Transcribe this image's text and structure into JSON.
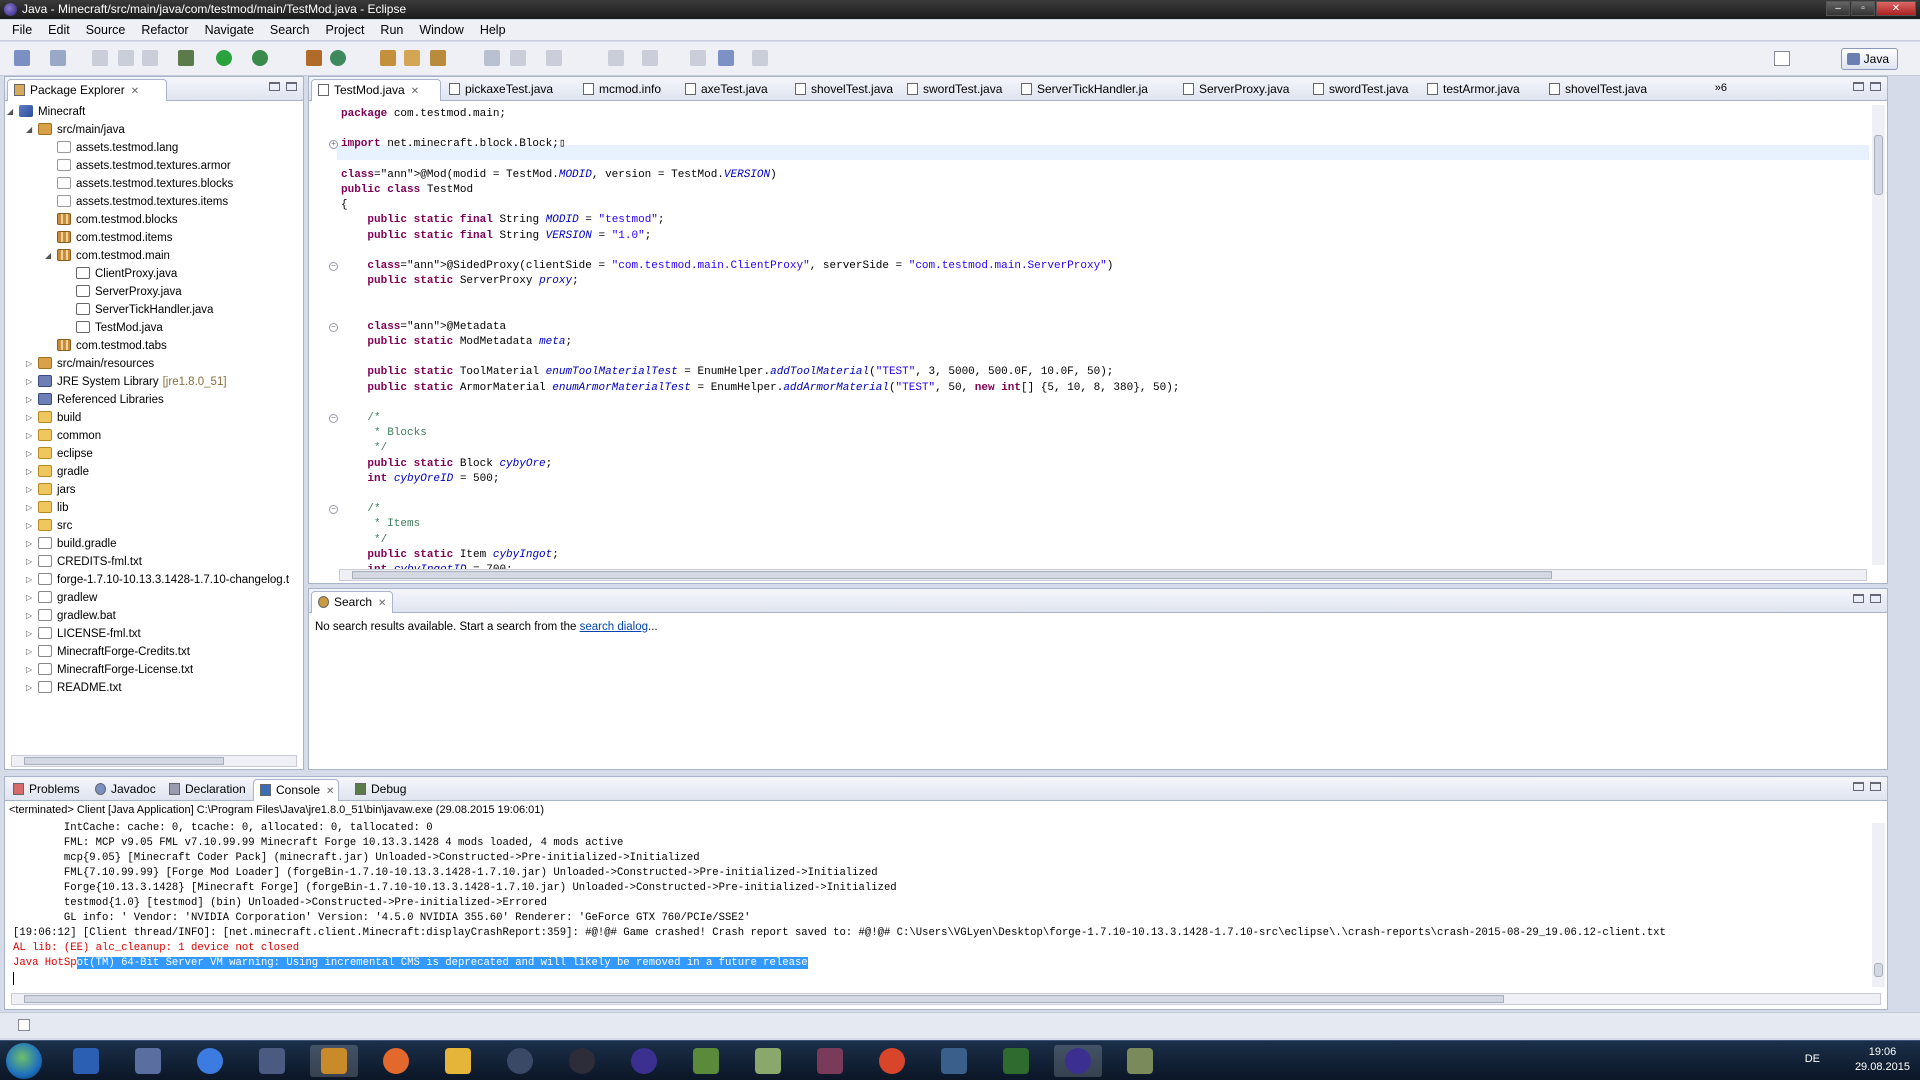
{
  "window": {
    "title": "Java - Minecraft/src/main/java/com/testmod/main/TestMod.java - Eclipse"
  },
  "menu": [
    "File",
    "Edit",
    "Source",
    "Refactor",
    "Navigate",
    "Search",
    "Project",
    "Run",
    "Window",
    "Help"
  ],
  "perspective": {
    "label": "Java"
  },
  "package_explorer": {
    "tab_label": "Package Explorer",
    "items": [
      {
        "label": "Minecraft",
        "icon": "project-icon",
        "level": 0,
        "expanded": true
      },
      {
        "label": "src/main/java",
        "icon": "source-folder-icon",
        "level": 1,
        "expanded": true
      },
      {
        "label": "assets.testmod.lang",
        "icon": "package-empty-icon",
        "level": 2
      },
      {
        "label": "assets.testmod.textures.armor",
        "icon": "package-empty-icon",
        "level": 2
      },
      {
        "label": "assets.testmod.textures.blocks",
        "icon": "package-empty-icon",
        "level": 2
      },
      {
        "label": "assets.testmod.textures.items",
        "icon": "package-empty-icon",
        "level": 2
      },
      {
        "label": "com.testmod.blocks",
        "icon": "package-icon",
        "level": 2
      },
      {
        "label": "com.testmod.items",
        "icon": "package-icon",
        "level": 2
      },
      {
        "label": "com.testmod.main",
        "icon": "package-icon",
        "level": 2,
        "expanded": true
      },
      {
        "label": "ClientProxy.java",
        "icon": "java-file-icon",
        "level": 3
      },
      {
        "label": "ServerProxy.java",
        "icon": "java-file-icon",
        "level": 3
      },
      {
        "label": "ServerTickHandler.java",
        "icon": "java-file-icon",
        "level": 3
      },
      {
        "label": "TestMod.java",
        "icon": "java-file-icon",
        "level": 3
      },
      {
        "label": "com.testmod.tabs",
        "icon": "package-icon",
        "level": 2
      },
      {
        "label": "src/main/resources",
        "icon": "source-folder-icon",
        "level": 1
      },
      {
        "label": "JRE System Library",
        "suffix": "[jre1.8.0_51]",
        "icon": "library-icon",
        "level": 1
      },
      {
        "label": "Referenced Libraries",
        "icon": "library-icon",
        "level": 1
      },
      {
        "label": "build",
        "icon": "folder-icon",
        "level": 1
      },
      {
        "label": "common",
        "icon": "folder-icon",
        "level": 1
      },
      {
        "label": "eclipse",
        "icon": "folder-icon",
        "level": 1
      },
      {
        "label": "gradle",
        "icon": "folder-icon",
        "level": 1
      },
      {
        "label": "jars",
        "icon": "folder-icon",
        "level": 1
      },
      {
        "label": "lib",
        "icon": "folder-icon",
        "level": 1
      },
      {
        "label": "src",
        "icon": "folder-icon",
        "level": 1
      },
      {
        "label": "build.gradle",
        "icon": "file-icon",
        "level": 1
      },
      {
        "label": "CREDITS-fml.txt",
        "icon": "file-icon",
        "level": 1
      },
      {
        "label": "forge-1.7.10-10.13.3.1428-1.7.10-changelog.t",
        "icon": "file-icon",
        "level": 1
      },
      {
        "label": "gradlew",
        "icon": "file-icon",
        "level": 1
      },
      {
        "label": "gradlew.bat",
        "icon": "file-icon",
        "level": 1
      },
      {
        "label": "LICENSE-fml.txt",
        "icon": "file-icon",
        "level": 1
      },
      {
        "label": "MinecraftForge-Credits.txt",
        "icon": "file-icon",
        "level": 1
      },
      {
        "label": "MinecraftForge-License.txt",
        "icon": "file-icon",
        "level": 1
      },
      {
        "label": "README.txt",
        "icon": "file-icon",
        "level": 1
      }
    ]
  },
  "editor": {
    "tabs": [
      "TestMod.java",
      "pickaxeTest.java",
      "mcmod.info",
      "axeTest.java",
      "shovelTest.java",
      "swordTest.java",
      "ServerTickHandler.ja",
      "ServerProxy.java",
      "swordTest.java",
      "testArmor.java",
      "shovelTest.java"
    ],
    "overflow_count": "»6",
    "lines": [
      {
        "t": "package com.testmod.main;"
      },
      {
        "t": ""
      },
      {
        "t": "import net.minecraft.block.Block;▯"
      },
      {
        "t": ""
      },
      {
        "t": "@Mod(modid = TestMod.MODID, version = TestMod.VERSION)"
      },
      {
        "t": "public class TestMod"
      },
      {
        "t": "{"
      },
      {
        "t": "    public static final String MODID = \"testmod\";"
      },
      {
        "t": "    public static final String VERSION = \"1.0\";"
      },
      {
        "t": ""
      },
      {
        "t": "    @SidedProxy(clientSide = \"com.testmod.main.ClientProxy\", serverSide = \"com.testmod.main.ServerProxy\")"
      },
      {
        "t": "    public static ServerProxy proxy;"
      },
      {
        "t": ""
      },
      {
        "t": ""
      },
      {
        "t": "    @Metadata"
      },
      {
        "t": "    public static ModMetadata meta;"
      },
      {
        "t": ""
      },
      {
        "t": "    public static ToolMaterial enumToolMaterialTest = EnumHelper.addToolMaterial(\"TEST\", 3, 5000, 500.0F, 10.0F, 50);"
      },
      {
        "t": "    public static ArmorMaterial enumArmorMaterialTest = EnumHelper.addArmorMaterial(\"TEST\", 50, new int[] {5, 10, 8, 380}, 50);"
      },
      {
        "t": ""
      },
      {
        "t": "    /*"
      },
      {
        "t": "     * Blocks"
      },
      {
        "t": "     */"
      },
      {
        "t": "    public static Block cybyOre;"
      },
      {
        "t": "    int cybyOreID = 500;"
      },
      {
        "t": ""
      },
      {
        "t": "    /*"
      },
      {
        "t": "     * Items"
      },
      {
        "t": "     */"
      },
      {
        "t": "    public static Item cybyIngot;"
      },
      {
        "t": "    int cybyIngotID = 700;"
      }
    ]
  },
  "search_view": {
    "tab_label": "Search",
    "message": "No search results available. Start a search from the ",
    "link": "search dialog",
    "after": "..."
  },
  "bottom_tabs": [
    "Problems",
    "Javadoc",
    "Declaration",
    "Console",
    "Debug"
  ],
  "console": {
    "title": "<terminated> Client [Java Application] C:\\Program Files\\Java\\jre1.8.0_51\\bin\\javaw.exe (29.08.2015 19:06:01)",
    "lines": [
      {
        "t": "        IntCache: cache: 0, tcache: 0, allocated: 0, tallocated: 0",
        "c": "n"
      },
      {
        "t": "        FML: MCP v9.05 FML v7.10.99.99 Minecraft Forge 10.13.3.1428 4 mods loaded, 4 mods active",
        "c": "n"
      },
      {
        "t": "        mcp{9.05} [Minecraft Coder Pack] (minecraft.jar) Unloaded->Constructed->Pre-initialized->Initialized",
        "c": "n"
      },
      {
        "t": "        FML{7.10.99.99} [Forge Mod Loader] (forgeBin-1.7.10-10.13.3.1428-1.7.10.jar) Unloaded->Constructed->Pre-initialized->Initialized",
        "c": "n"
      },
      {
        "t": "        Forge{10.13.3.1428} [Minecraft Forge] (forgeBin-1.7.10-10.13.3.1428-1.7.10.jar) Unloaded->Constructed->Pre-initialized->Initialized",
        "c": "n"
      },
      {
        "t": "        testmod{1.0} [testmod] (bin) Unloaded->Constructed->Pre-initialized->Errored",
        "c": "n"
      },
      {
        "t": "        GL info: ' Vendor: 'NVIDIA Corporation' Version: '4.5.0 NVIDIA 355.60' Renderer: 'GeForce GTX 760/PCIe/SSE2'",
        "c": "n"
      },
      {
        "t": "[19:06:12] [Client thread/INFO]: [net.minecraft.client.Minecraft:displayCrashReport:359]: #@!@# Game crashed! Crash report saved to: #@!@# C:\\Users\\VGLyen\\Desktop\\forge-1.7.10-10.13.3.1428-1.7.10-src\\eclipse\\.\\crash-reports\\crash-2015-08-29_19.06.12-client.txt",
        "c": "n"
      },
      {
        "t": "AL lib: (EE) alc_cleanup: 1 device not closed",
        "c": "red"
      }
    ],
    "last_line_prefix": "Java HotSp",
    "last_line_selected": "ot(TM) 64-Bit Server VM warning: Using incremental CMS is deprecated and will likely be removed in a future release"
  },
  "taskbar": {
    "language": "DE",
    "time": "19:06",
    "date": "29.08.2015",
    "apps": [
      "word-icon",
      "snipping-icon",
      "google-icon",
      "security-icon",
      "folder-lock-icon",
      "firefox-icon",
      "explorer-icon",
      "steam-icon",
      "obs-icon",
      "eclipse-icon",
      "minecraft-icon",
      "editor-icon",
      "fraps-icon",
      "chrome-icon",
      "teamspeak-icon",
      "creeper-icon",
      "eclipse-active-icon",
      "launcher-icon"
    ]
  }
}
